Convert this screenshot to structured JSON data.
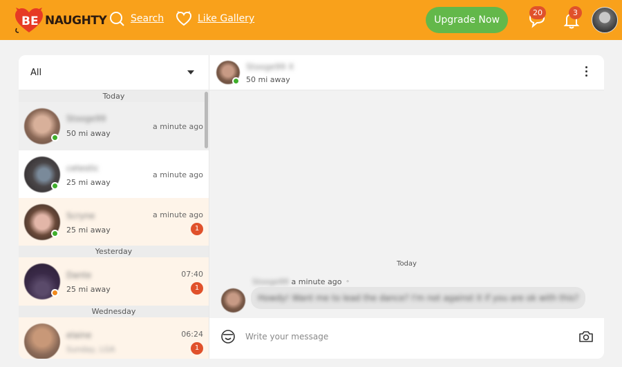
{
  "brand": {
    "logo_be": "BE",
    "logo_naughty": "NAUGHTY"
  },
  "nav": {
    "search": "Search",
    "like_gallery": "Like Gallery"
  },
  "header": {
    "upgrade": "Upgrade Now",
    "messages_count": "20",
    "notifications_count": "3"
  },
  "filter": {
    "value": "All"
  },
  "sections": {
    "today": "Today",
    "yesterday": "Yesterday",
    "wednesday": "Wednesday"
  },
  "conversations": [
    {
      "name": "Stooge99",
      "distance": "50 mi away",
      "time": "a minute ago",
      "unread": "",
      "status": "online"
    },
    {
      "name": "cetestic",
      "distance": "25 mi away",
      "time": "a minute ago",
      "unread": "",
      "status": "online"
    },
    {
      "name": "Scryne",
      "distance": "25 mi away",
      "time": "a minute ago",
      "unread": "1",
      "status": "online"
    },
    {
      "name": "Dante",
      "distance": "25 mi away",
      "time": "07:40",
      "unread": "1",
      "status": "away"
    },
    {
      "name": "elaine",
      "distance": "Sunday, LGA",
      "time": "06:24",
      "unread": "1",
      "status": ""
    }
  ],
  "chat": {
    "header_name": "Stooge99 X",
    "header_distance": "50 mi away",
    "day_label": "Today",
    "message": {
      "sender": "Stooge99",
      "time": "a minute ago",
      "text": "Howdy! Want me to lead the dance? I'm not against it if you are ok with this?"
    },
    "input_placeholder": "Write your message"
  },
  "colors": {
    "header_bg": "#f9a11b",
    "upgrade_bg": "#63b84a",
    "badge": "#e0512b",
    "online": "#3fae2b",
    "away": "#f28a1d"
  }
}
